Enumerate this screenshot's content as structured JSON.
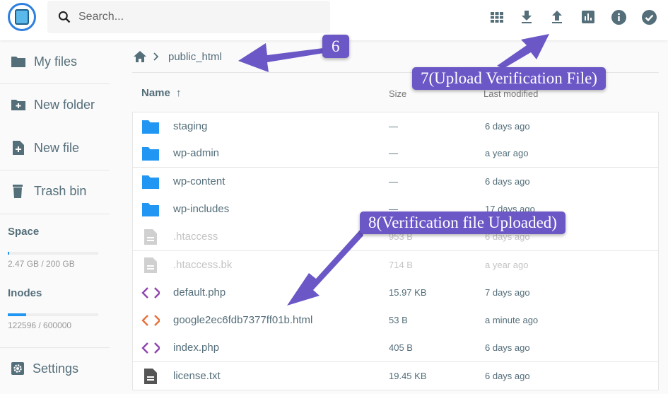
{
  "header": {
    "search_placeholder": "Search...",
    "icons": [
      "grid-view-icon",
      "download-icon",
      "upload-icon",
      "stats-icon",
      "info-icon",
      "check-icon"
    ]
  },
  "sidebar": {
    "items": [
      {
        "label": "My files",
        "icon": "folder-icon"
      },
      {
        "label": "New folder",
        "icon": "folder-plus-icon"
      },
      {
        "label": "New file",
        "icon": "file-plus-icon"
      },
      {
        "label": "Trash bin",
        "icon": "trash-icon"
      }
    ],
    "space": {
      "label": "Space",
      "text": "2.47 GB / 200 GB",
      "percent": 1.2
    },
    "inodes": {
      "label": "Inodes",
      "text": "122596 / 600000",
      "percent": 20.4
    },
    "settings": "Settings"
  },
  "breadcrumb": {
    "path": "public_html"
  },
  "table": {
    "columns": {
      "name": "Name",
      "size": "Size",
      "modified": "Last modified"
    },
    "rows": [
      {
        "name": "staging",
        "size": "—",
        "modified": "6 days ago",
        "type": "folder"
      },
      {
        "name": "wp-admin",
        "size": "—",
        "modified": "a year ago",
        "type": "folder"
      },
      {
        "name": "wp-content",
        "size": "—",
        "modified": "6 days ago",
        "type": "folder"
      },
      {
        "name": "wp-includes",
        "size": "—",
        "modified": "17 days ago",
        "type": "folder"
      },
      {
        "name": ".htaccess",
        "size": "953 B",
        "modified": "6 days ago",
        "type": "hidden"
      },
      {
        "name": ".htaccess.bk",
        "size": "714 B",
        "modified": "a year ago",
        "type": "hidden"
      },
      {
        "name": "default.php",
        "size": "15.97 KB",
        "modified": "7 days ago",
        "type": "php"
      },
      {
        "name": "google2ec6fdb7377ff01b.html",
        "size": "53 B",
        "modified": "a minute ago",
        "type": "html"
      },
      {
        "name": "index.php",
        "size": "405 B",
        "modified": "6 days ago",
        "type": "php"
      },
      {
        "name": "license.txt",
        "size": "19.45 KB",
        "modified": "6 days ago",
        "type": "text"
      }
    ]
  },
  "annotations": [
    "6",
    "7(Upload Verification File)",
    "8(Verification file Uploaded)"
  ],
  "colors": {
    "accent": "#2196f3",
    "callout": "#6b57c6",
    "php": "#8e44ad",
    "html": "#e8703a",
    "icon": "#546e7a"
  }
}
